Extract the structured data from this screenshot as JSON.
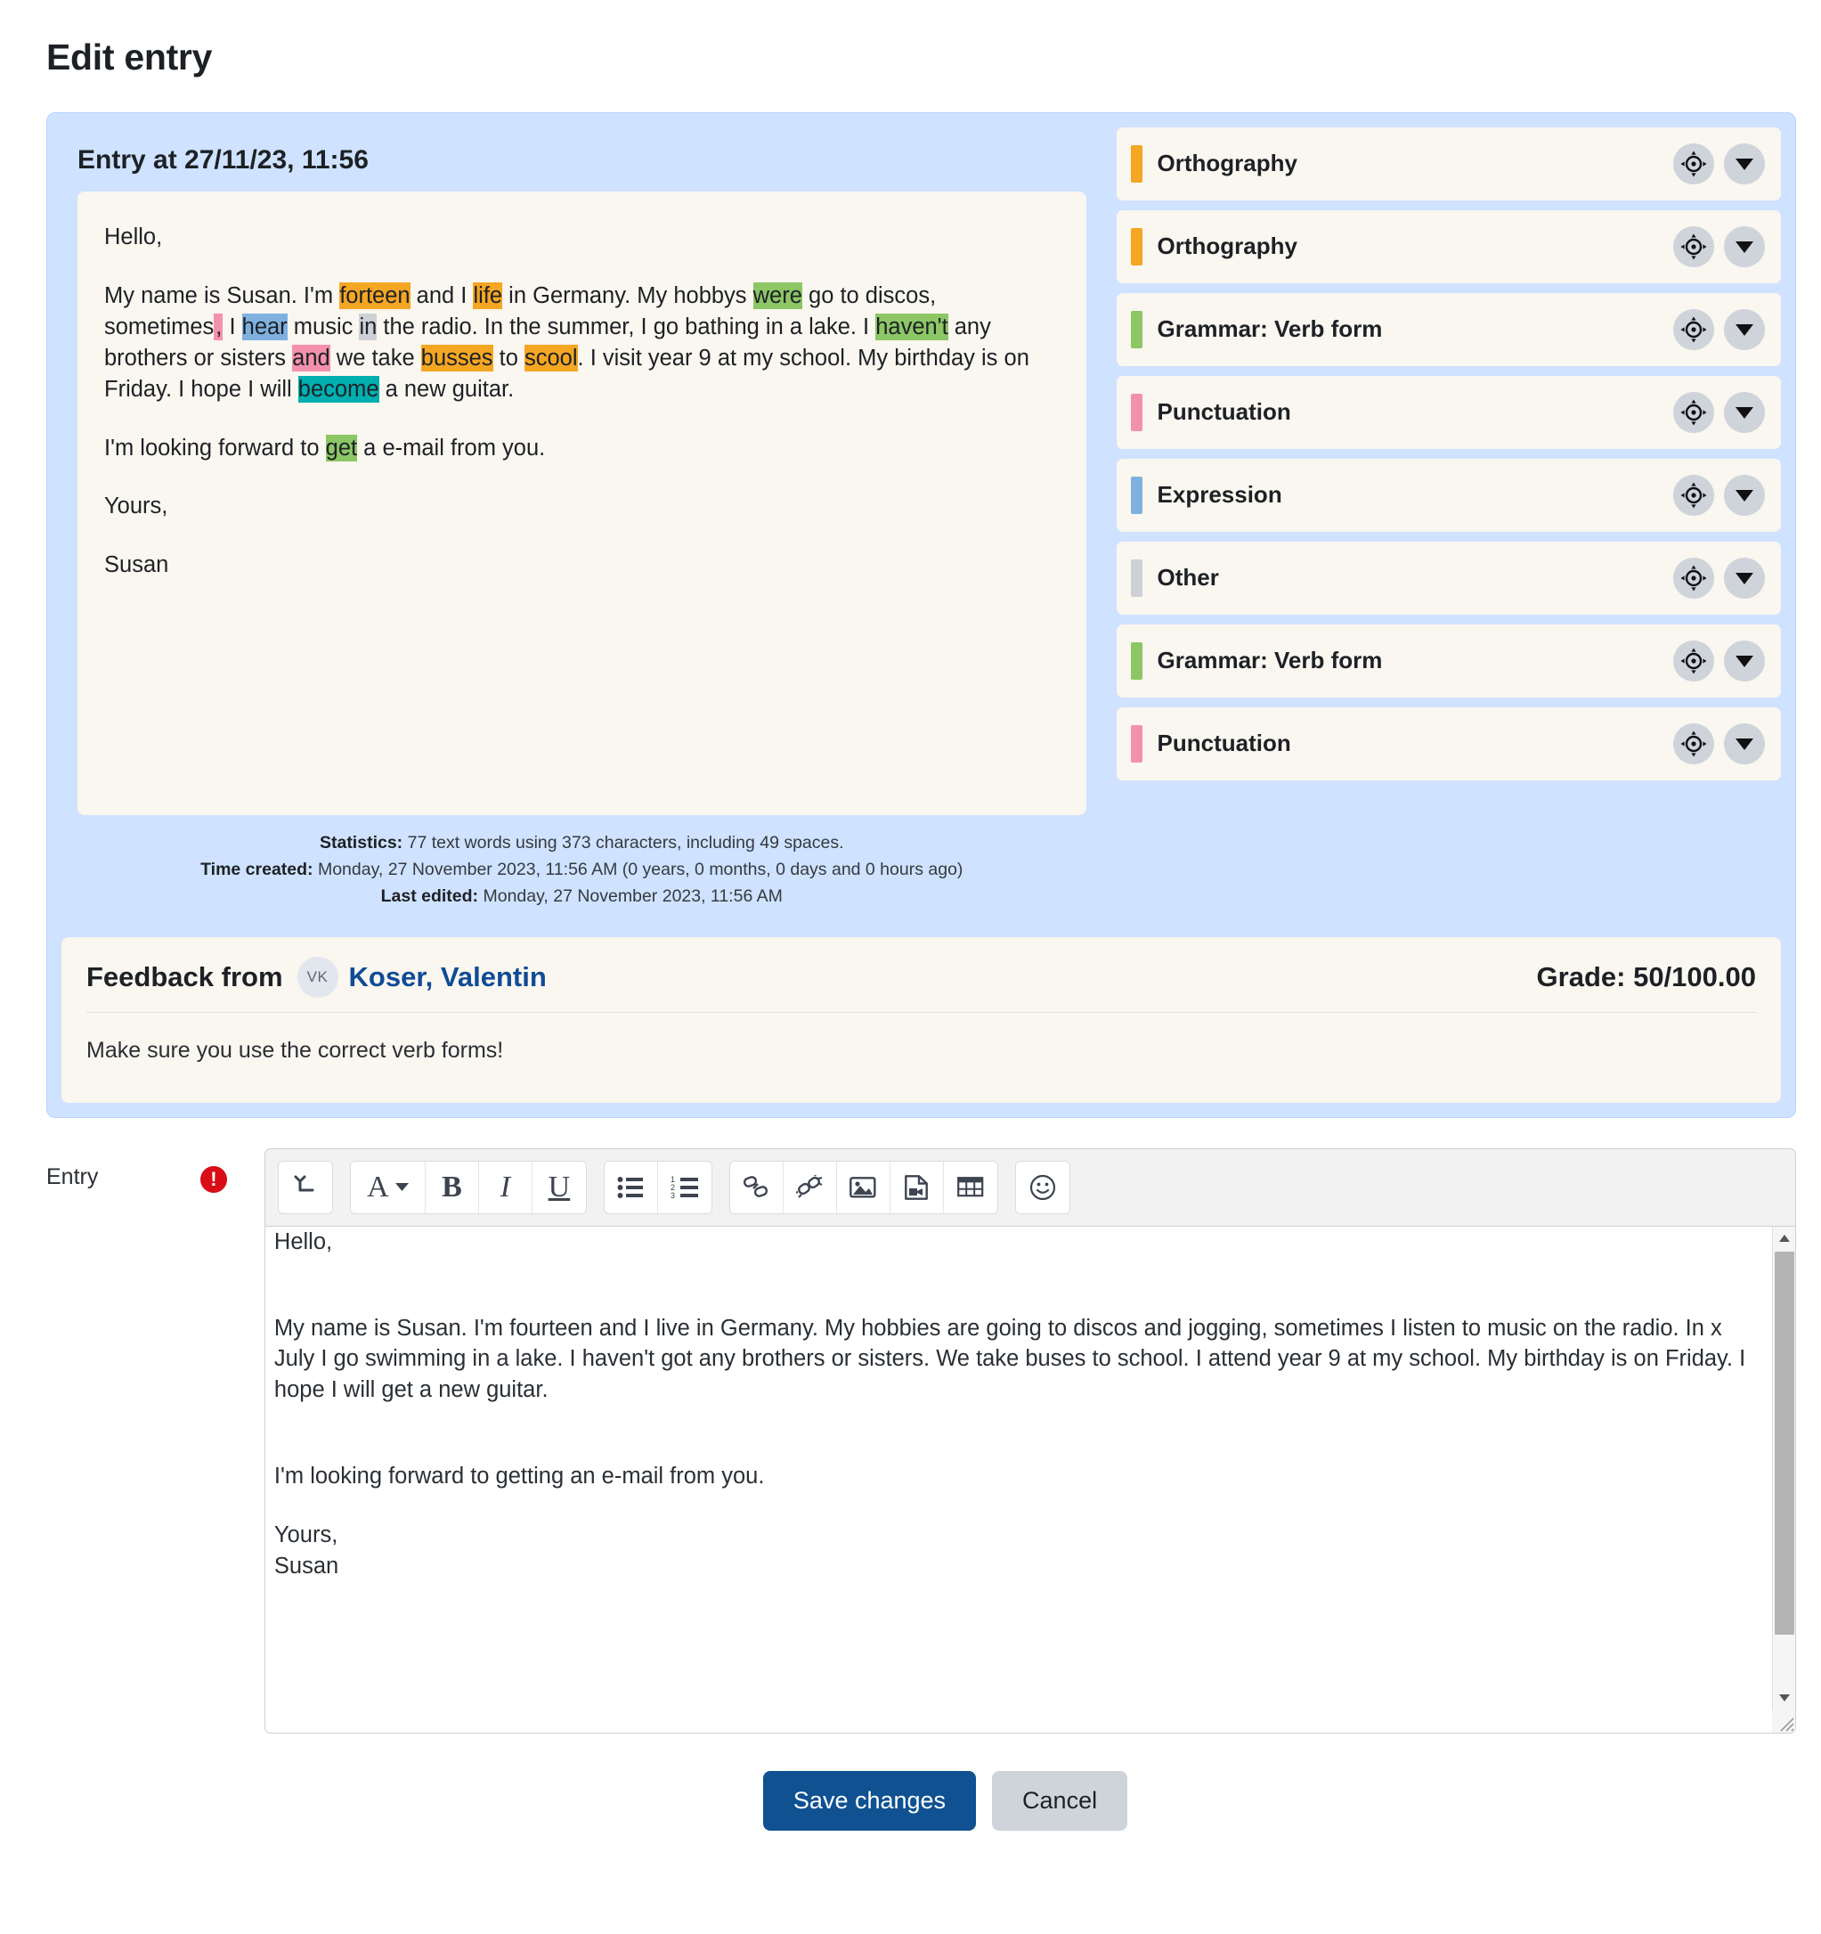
{
  "page": {
    "title": "Edit entry"
  },
  "entry": {
    "heading": "Entry at 27/11/23, 11:56",
    "salutation": "Hello,",
    "body": {
      "seg1": "My name is Susan. I'm ",
      "h_forteen": "forteen",
      "seg2": " and I ",
      "h_life": "life",
      "seg3": " in Germany. My hobbys ",
      "h_were": "were",
      "seg4": " go to discos, sometimes",
      "h_comma": ",",
      "seg5": " I ",
      "h_hear": "hear",
      "seg6": " music ",
      "h_in": "in",
      "seg7": " the radio. In the summer, I go bathing in a lake. I ",
      "h_havent": "haven't",
      "seg8": " any brothers or sisters ",
      "h_and": "and",
      "seg9": " we take ",
      "h_busses": "busses",
      "seg10": " to ",
      "h_scool": "scool",
      "seg11": ". I visit year 9 at my school. My birthday is on Friday. I hope I will ",
      "h_become": "become",
      "seg12": " a new guitar."
    },
    "para_forward_pre": "I'm looking forward to ",
    "para_forward_hl": "get",
    "para_forward_post": " a e-mail from you.",
    "yours": "Yours,",
    "signature": "Susan",
    "stats": {
      "stats_label": "Statistics:",
      "stats_value": "77 text words using 373 characters, including 49 spaces.",
      "created_label": "Time created:",
      "created_value": "Monday, 27 November 2023, 11:56 AM (0 years, 0 months, 0 days and 0 hours ago)",
      "edited_label": "Last edited:",
      "edited_value": "Monday, 27 November 2023, 11:56 AM"
    }
  },
  "annotations": {
    "items": [
      {
        "label": "Orthography",
        "color": "#f5a623"
      },
      {
        "label": "Orthography",
        "color": "#f5a623"
      },
      {
        "label": "Grammar: Verb form",
        "color": "#8cc665"
      },
      {
        "label": "Punctuation",
        "color": "#f391ad"
      },
      {
        "label": "Expression",
        "color": "#7fb1e0"
      },
      {
        "label": "Other",
        "color": "#cdd0d4"
      },
      {
        "label": "Grammar: Verb form",
        "color": "#8cc665"
      },
      {
        "label": "Punctuation",
        "color": "#f391ad"
      }
    ]
  },
  "feedback": {
    "title": "Feedback from",
    "avatar_initials": "VK",
    "author": "Koser, Valentin",
    "grade": "Grade: 50/100.00",
    "comment": "Make sure you use the correct verb forms!"
  },
  "form": {
    "label": "Entry",
    "required_marker": "!",
    "toolbar": {
      "items": [
        {
          "name": "paragraph-style-icon",
          "glyph": "⤵"
        },
        {
          "name": "font-color-icon",
          "glyph": "A"
        },
        {
          "name": "bold-icon",
          "glyph": "B"
        },
        {
          "name": "italic-icon",
          "glyph": "I"
        },
        {
          "name": "underline-icon",
          "glyph": "U"
        },
        {
          "name": "bullet-list-icon",
          "glyph": ""
        },
        {
          "name": "numbered-list-icon",
          "glyph": ""
        },
        {
          "name": "insert-link-icon",
          "glyph": ""
        },
        {
          "name": "unlink-icon",
          "glyph": ""
        },
        {
          "name": "insert-image-icon",
          "glyph": ""
        },
        {
          "name": "insert-media-icon",
          "glyph": ""
        },
        {
          "name": "insert-table-icon",
          "glyph": ""
        },
        {
          "name": "emoji-icon",
          "glyph": ""
        }
      ]
    },
    "editor_text": {
      "salutation": "Hello,",
      "paragraph": "My name is Susan. I'm fourteen and I live in Germany. My hobbies are going to discos and jogging, sometimes I listen to music on the radio. In x July I go swimming in a lake. I haven't got any brothers or sisters. We take buses to school. I attend year 9 at my school. My birthday is on Friday. I hope I will get a new guitar.",
      "forward": "I'm looking forward to getting an e-mail from you.",
      "yours": "Yours,",
      "signature": "Susan"
    },
    "save_label": "Save changes",
    "cancel_label": "Cancel"
  }
}
